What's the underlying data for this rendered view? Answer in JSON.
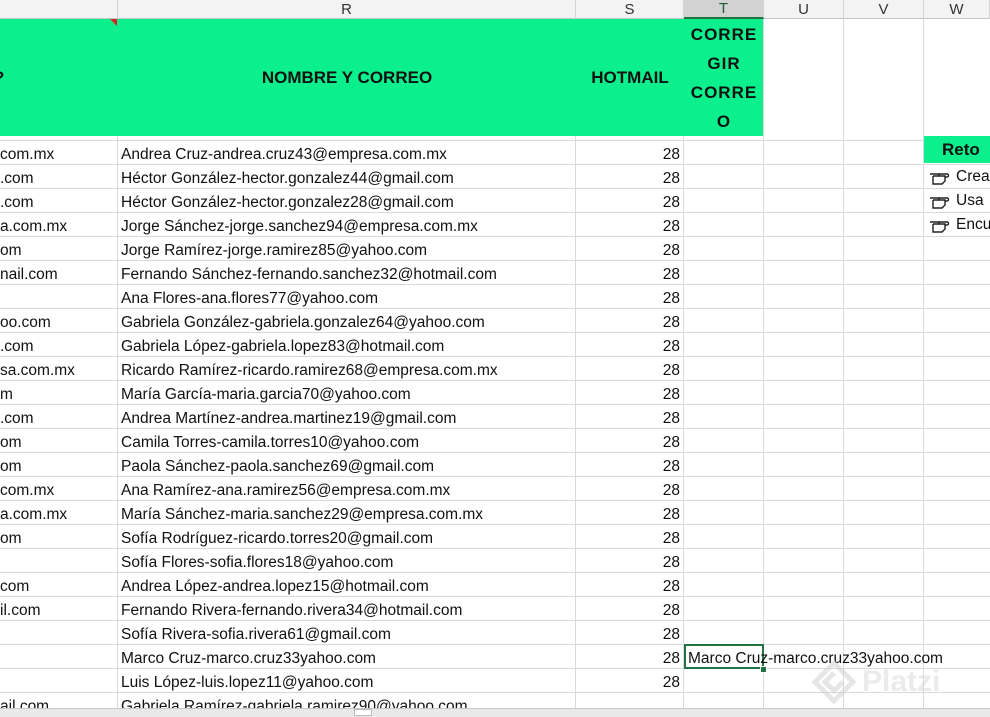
{
  "columns": {
    "R": "R",
    "S": "S",
    "T": "T",
    "U": "U",
    "V": "V",
    "W": "W"
  },
  "header": {
    "q": "?",
    "r": "NOMBRE Y CORREO",
    "s": "HOTMAIL",
    "t_lines": [
      "CORRE",
      "GIR",
      "CORRE",
      "O"
    ]
  },
  "rows": [
    {
      "q": "com.mx",
      "r": "Andrea Cruz-andrea.cruz43@empresa.com.mx",
      "s": "28"
    },
    {
      "q": ".com",
      "r": "Héctor González-hector.gonzalez44@gmail.com",
      "s": "28"
    },
    {
      "q": ".com",
      "r": "Héctor González-hector.gonzalez28@gmail.com",
      "s": "28"
    },
    {
      "q": "a.com.mx",
      "r": "Jorge Sánchez-jorge.sanchez94@empresa.com.mx",
      "s": "28"
    },
    {
      "q": "om",
      "r": "Jorge Ramírez-jorge.ramirez85@yahoo.com",
      "s": "28"
    },
    {
      "q": "nail.com",
      "r": "Fernando Sánchez-fernando.sanchez32@hotmail.com",
      "s": "28"
    },
    {
      "q": "",
      "r": "Ana Flores-ana.flores77@yahoo.com",
      "s": "28"
    },
    {
      "q": "oo.com",
      "r": "Gabriela González-gabriela.gonzalez64@yahoo.com",
      "s": "28"
    },
    {
      "q": ".com",
      "r": "Gabriela López-gabriela.lopez83@hotmail.com",
      "s": "28"
    },
    {
      "q": "sa.com.mx",
      "r": "Ricardo Ramírez-ricardo.ramirez68@empresa.com.mx",
      "s": "28"
    },
    {
      "q": "m",
      "r": "María García-maria.garcia70@yahoo.com",
      "s": "28"
    },
    {
      "q": ".com",
      "r": "Andrea Martínez-andrea.martinez19@gmail.com",
      "s": "28"
    },
    {
      "q": "om",
      "r": "Camila Torres-camila.torres10@yahoo.com",
      "s": "28"
    },
    {
      "q": "om",
      "r": "Paola Sánchez-paola.sanchez69@gmail.com",
      "s": "28"
    },
    {
      "q": "com.mx",
      "r": "Ana Ramírez-ana.ramirez56@empresa.com.mx",
      "s": "28"
    },
    {
      "q": "a.com.mx",
      "r": "María Sánchez-maria.sanchez29@empresa.com.mx",
      "s": "28"
    },
    {
      "q": "om",
      "r": "Sofía Rodríguez-ricardo.torres20@gmail.com",
      "s": "28"
    },
    {
      "q": "",
      "r": "Sofía Flores-sofia.flores18@yahoo.com",
      "s": "28"
    },
    {
      "q": "com",
      "r": "Andrea López-andrea.lopez15@hotmail.com",
      "s": "28"
    },
    {
      "q": "il.com",
      "r": "Fernando Rivera-fernando.rivera34@hotmail.com",
      "s": "28"
    },
    {
      "q": "",
      "r": "Sofía Rivera-sofia.rivera61@gmail.com",
      "s": "28"
    },
    {
      "q": "",
      "r": "Marco Cruz-marco.cruz33yahoo.com",
      "s": "28"
    },
    {
      "q": "",
      "r": "Luis López-luis.lopez11@yahoo.com",
      "s": "28"
    },
    {
      "q": "ail.com",
      "r": "Gabriela Ramírez-gabriela.ramirez90@yahoo.com",
      "s": ""
    }
  ],
  "active_cell_text": "Marco Cruz-marco.cruz33yahoo.com",
  "reto": {
    "title": "Reto",
    "items": [
      "Crea",
      "Usa",
      "Encu"
    ],
    "icon": "pointing-hand-icon"
  },
  "watermark": "Platzi",
  "colors": {
    "header_green": "#0bef8c",
    "selection_green": "#217346",
    "grid": "#d9d9d9",
    "comment_red": "#dd2222"
  }
}
